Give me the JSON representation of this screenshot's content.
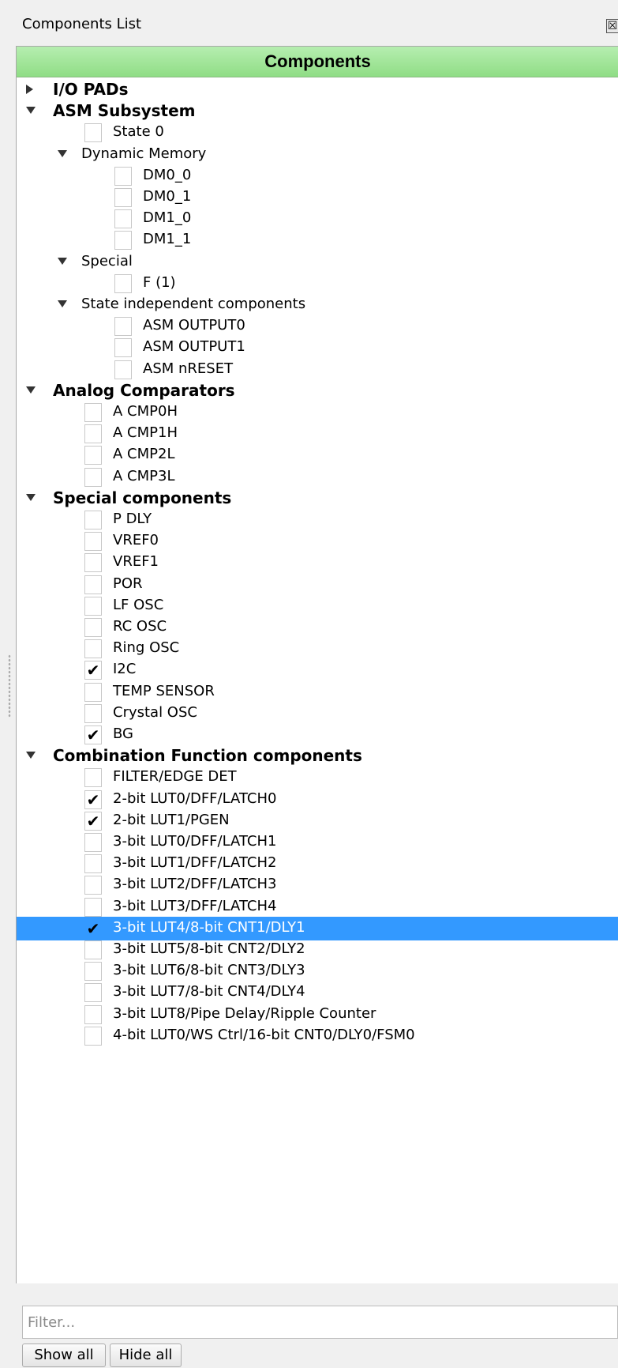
{
  "window": {
    "title": "Components List",
    "close_symbol": "☒"
  },
  "header": {
    "title": "Components"
  },
  "tree": [
    {
      "kind": "cat",
      "label": "I/O PADs",
      "arrow": "right"
    },
    {
      "kind": "cat",
      "label": "ASM Subsystem",
      "arrow": "down"
    },
    {
      "kind": "item",
      "label": "State 0",
      "level": 1,
      "checked": false
    },
    {
      "kind": "sub",
      "label": "Dynamic Memory",
      "arrow": "down"
    },
    {
      "kind": "item",
      "label": "DM0_0",
      "level": 2,
      "checked": false
    },
    {
      "kind": "item",
      "label": "DM0_1",
      "level": 2,
      "checked": false
    },
    {
      "kind": "item",
      "label": "DM1_0",
      "level": 2,
      "checked": false
    },
    {
      "kind": "item",
      "label": "DM1_1",
      "level": 2,
      "checked": false
    },
    {
      "kind": "sub",
      "label": "Special",
      "arrow": "down"
    },
    {
      "kind": "item",
      "label": "F (1)",
      "level": 2,
      "checked": false
    },
    {
      "kind": "sub",
      "label": "State independent components",
      "arrow": "down"
    },
    {
      "kind": "item",
      "label": "ASM OUTPUT0",
      "level": 2,
      "checked": false
    },
    {
      "kind": "item",
      "label": "ASM OUTPUT1",
      "level": 2,
      "checked": false
    },
    {
      "kind": "item",
      "label": "ASM nRESET",
      "level": 2,
      "checked": false
    },
    {
      "kind": "cat",
      "label": "Analog Comparators",
      "arrow": "down"
    },
    {
      "kind": "item",
      "label": "A CMP0H",
      "level": 1,
      "checked": false
    },
    {
      "kind": "item",
      "label": "A CMP1H",
      "level": 1,
      "checked": false
    },
    {
      "kind": "item",
      "label": "A CMP2L",
      "level": 1,
      "checked": false
    },
    {
      "kind": "item",
      "label": "A CMP3L",
      "level": 1,
      "checked": false
    },
    {
      "kind": "cat",
      "label": "Special components",
      "arrow": "down"
    },
    {
      "kind": "item",
      "label": "P DLY",
      "level": 1,
      "checked": false
    },
    {
      "kind": "item",
      "label": "VREF0",
      "level": 1,
      "checked": false
    },
    {
      "kind": "item",
      "label": "VREF1",
      "level": 1,
      "checked": false
    },
    {
      "kind": "item",
      "label": "POR",
      "level": 1,
      "checked": false
    },
    {
      "kind": "item",
      "label": "LF OSC",
      "level": 1,
      "checked": false
    },
    {
      "kind": "item",
      "label": "RC OSC",
      "level": 1,
      "checked": false
    },
    {
      "kind": "item",
      "label": "Ring OSC",
      "level": 1,
      "checked": false
    },
    {
      "kind": "item",
      "label": "I2C",
      "level": 1,
      "checked": true
    },
    {
      "kind": "item",
      "label": "TEMP SENSOR",
      "level": 1,
      "checked": false
    },
    {
      "kind": "item",
      "label": "Crystal OSC",
      "level": 1,
      "checked": false
    },
    {
      "kind": "item",
      "label": "BG",
      "level": 1,
      "checked": true
    },
    {
      "kind": "cat",
      "label": "Combination Function components",
      "arrow": "down"
    },
    {
      "kind": "item",
      "label": "FILTER/EDGE DET",
      "level": 1,
      "checked": false
    },
    {
      "kind": "item",
      "label": "2-bit LUT0/DFF/LATCH0",
      "level": 1,
      "checked": true
    },
    {
      "kind": "item",
      "label": "2-bit LUT1/PGEN",
      "level": 1,
      "checked": true
    },
    {
      "kind": "item",
      "label": "3-bit LUT0/DFF/LATCH1",
      "level": 1,
      "checked": false
    },
    {
      "kind": "item",
      "label": "3-bit LUT1/DFF/LATCH2",
      "level": 1,
      "checked": false
    },
    {
      "kind": "item",
      "label": "3-bit LUT2/DFF/LATCH3",
      "level": 1,
      "checked": false
    },
    {
      "kind": "item",
      "label": "3-bit LUT3/DFF/LATCH4",
      "level": 1,
      "checked": false
    },
    {
      "kind": "item",
      "label": "3-bit LUT4/8-bit CNT1/DLY1",
      "level": 1,
      "checked": true,
      "selected": true
    },
    {
      "kind": "item",
      "label": "3-bit LUT5/8-bit CNT2/DLY2",
      "level": 1,
      "checked": false
    },
    {
      "kind": "item",
      "label": "3-bit LUT6/8-bit CNT3/DLY3",
      "level": 1,
      "checked": false
    },
    {
      "kind": "item",
      "label": "3-bit LUT7/8-bit CNT4/DLY4",
      "level": 1,
      "checked": false
    },
    {
      "kind": "item",
      "label": "3-bit LUT8/Pipe Delay/Ripple Counter",
      "level": 1,
      "checked": false
    },
    {
      "kind": "item",
      "label": "4-bit LUT0/WS Ctrl/16-bit CNT0/DLY0/FSM0",
      "level": 1,
      "checked": false
    }
  ],
  "filter": {
    "placeholder": "Filter...",
    "value": ""
  },
  "buttons": {
    "show_all": "Show all",
    "hide_all": "Hide all"
  },
  "colors": {
    "header_green": "#8fdd85",
    "selection_blue": "#3399ff"
  },
  "check_symbol": "✔"
}
